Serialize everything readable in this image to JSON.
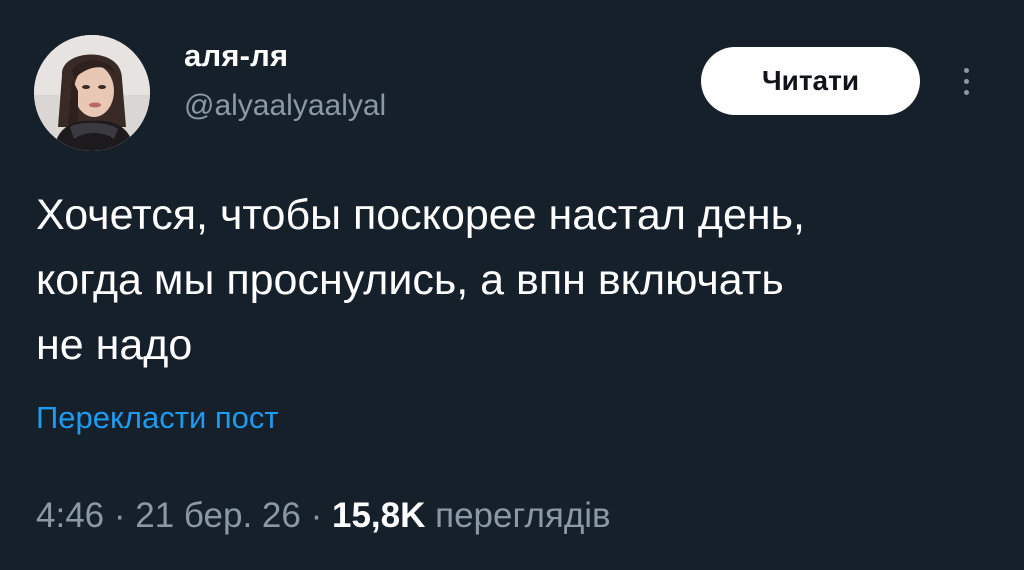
{
  "author": {
    "display_name": "аля-ля",
    "handle": "@alyaalyaalyal"
  },
  "actions": {
    "follow_label": "Читати",
    "more_icon": "more-vertical-icon"
  },
  "tweet": {
    "text": "Хочется, чтобы поскорее настал день,\nкогда мы проснулись, а впн включать\nне надо",
    "translate_label": "Перекласти пост"
  },
  "meta": {
    "time": "4:46",
    "separator": "·",
    "date": "21 бер. 26",
    "views_count": "15,8K",
    "views_label": "переглядів"
  },
  "colors": {
    "background": "#15202b",
    "text_primary": "#ffffff",
    "text_secondary": "#8b98a5",
    "link": "#1d9bf0",
    "button_bg": "#ffffff",
    "button_text": "#0f1419"
  }
}
